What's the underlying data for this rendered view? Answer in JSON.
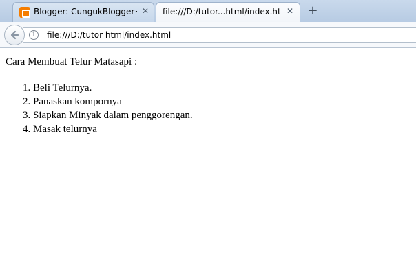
{
  "tabs": [
    {
      "label": "Blogger: CungukBlogger~...",
      "favicon": "blogger-icon",
      "active": false
    },
    {
      "label": "file:///D:/tutor...html/index.html",
      "active": true
    }
  ],
  "navbar": {
    "url": "file:///D:/tutor html/index.html"
  },
  "page": {
    "intro": "Cara Membuat Telur Matasapi :",
    "steps": [
      "Beli Telurnya.",
      "Panaskan kompornya",
      "Siapkan Minyak dalam penggorengan.",
      "Masak telurnya"
    ]
  },
  "icons": {
    "close": "close-icon",
    "new_tab": "plus-icon",
    "back": "back-arrow-icon",
    "info": "info-icon"
  },
  "colors": {
    "blogger_orange": "#f57d00",
    "tabstrip": "#c9d9ec"
  }
}
